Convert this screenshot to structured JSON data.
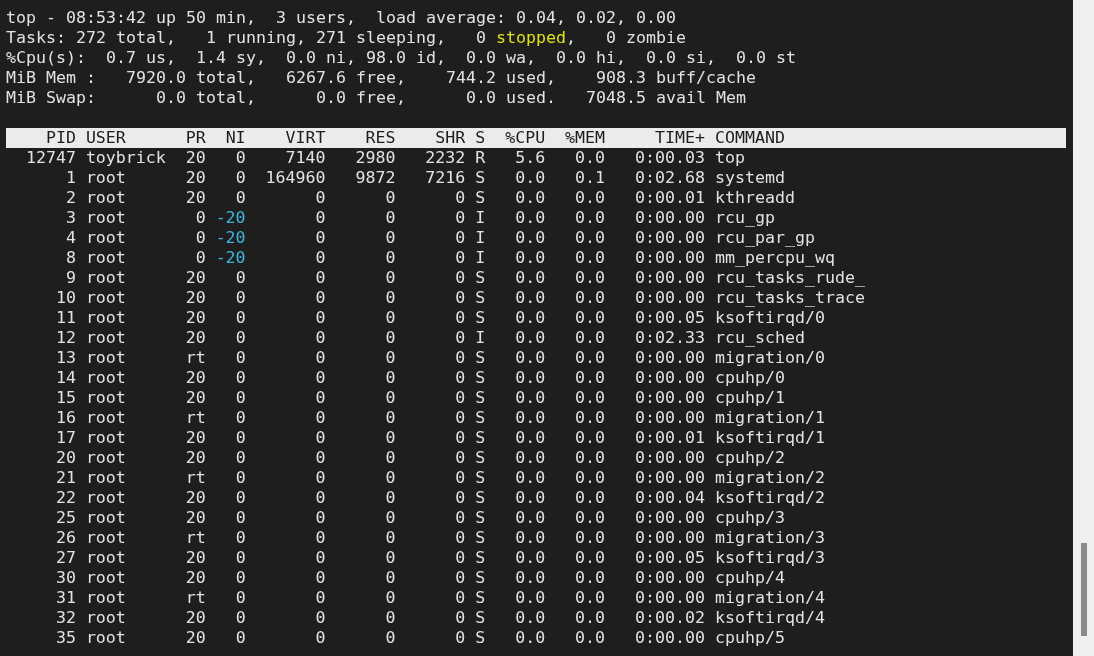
{
  "summary": [
    {
      "segments": [
        {
          "text": "top - 08:53:42 up 50 min,  3 users,  load average: 0.04, 0.02, 0.00",
          "highlighted": false
        }
      ]
    },
    {
      "segments": [
        {
          "text": "Tasks: 272 total,   1 running, 271 sleeping,   0 ",
          "highlighted": false
        },
        {
          "text": "stopped",
          "highlighted": true
        },
        {
          "text": ",   0 zombie",
          "highlighted": false
        }
      ]
    },
    {
      "segments": [
        {
          "text": "%Cpu(s):  0.7 us,  1.4 sy,  0.0 ni, 98.0 id,  0.0 wa,  0.0 hi,  0.0 si,  0.0 st",
          "highlighted": false
        }
      ]
    },
    {
      "segments": [
        {
          "text": "MiB Mem :   7920.0 total,   6267.6 free,    744.2 used,    908.3 buff/cache",
          "highlighted": false
        }
      ]
    },
    {
      "segments": [
        {
          "text": "MiB Swap:      0.0 total,      0.0 free,      0.0 used.   7048.5 avail Mem",
          "highlighted": false
        }
      ]
    }
  ],
  "process_table": {
    "columns": [
      "PID",
      "USER",
      "PR",
      "NI",
      "VIRT",
      "RES",
      "SHR",
      "S",
      "%CPU",
      "%MEM",
      "TIME+",
      "COMMAND"
    ],
    "rows": [
      {
        "cells": [
          "12747",
          "toybrick",
          "20",
          "0",
          "7140",
          "2980",
          "2232",
          "R",
          "5.6",
          "0.0",
          "0:00.03",
          "top"
        ],
        "ni_highlighted": false
      },
      {
        "cells": [
          "1",
          "root",
          "20",
          "0",
          "164960",
          "9872",
          "7216",
          "S",
          "0.0",
          "0.1",
          "0:02.68",
          "systemd"
        ],
        "ni_highlighted": false
      },
      {
        "cells": [
          "2",
          "root",
          "20",
          "0",
          "0",
          "0",
          "0",
          "S",
          "0.0",
          "0.0",
          "0:00.01",
          "kthreadd"
        ],
        "ni_highlighted": false
      },
      {
        "cells": [
          "3",
          "root",
          "0",
          "-20",
          "0",
          "0",
          "0",
          "I",
          "0.0",
          "0.0",
          "0:00.00",
          "rcu_gp"
        ],
        "ni_highlighted": true
      },
      {
        "cells": [
          "4",
          "root",
          "0",
          "-20",
          "0",
          "0",
          "0",
          "I",
          "0.0",
          "0.0",
          "0:00.00",
          "rcu_par_gp"
        ],
        "ni_highlighted": true
      },
      {
        "cells": [
          "8",
          "root",
          "0",
          "-20",
          "0",
          "0",
          "0",
          "I",
          "0.0",
          "0.0",
          "0:00.00",
          "mm_percpu_wq"
        ],
        "ni_highlighted": true
      },
      {
        "cells": [
          "9",
          "root",
          "20",
          "0",
          "0",
          "0",
          "0",
          "S",
          "0.0",
          "0.0",
          "0:00.00",
          "rcu_tasks_rude_"
        ],
        "ni_highlighted": false
      },
      {
        "cells": [
          "10",
          "root",
          "20",
          "0",
          "0",
          "0",
          "0",
          "S",
          "0.0",
          "0.0",
          "0:00.00",
          "rcu_tasks_trace"
        ],
        "ni_highlighted": false
      },
      {
        "cells": [
          "11",
          "root",
          "20",
          "0",
          "0",
          "0",
          "0",
          "S",
          "0.0",
          "0.0",
          "0:00.05",
          "ksoftirqd/0"
        ],
        "ni_highlighted": false
      },
      {
        "cells": [
          "12",
          "root",
          "20",
          "0",
          "0",
          "0",
          "0",
          "I",
          "0.0",
          "0.0",
          "0:02.33",
          "rcu_sched"
        ],
        "ni_highlighted": false
      },
      {
        "cells": [
          "13",
          "root",
          "rt",
          "0",
          "0",
          "0",
          "0",
          "S",
          "0.0",
          "0.0",
          "0:00.00",
          "migration/0"
        ],
        "ni_highlighted": false
      },
      {
        "cells": [
          "14",
          "root",
          "20",
          "0",
          "0",
          "0",
          "0",
          "S",
          "0.0",
          "0.0",
          "0:00.00",
          "cpuhp/0"
        ],
        "ni_highlighted": false
      },
      {
        "cells": [
          "15",
          "root",
          "20",
          "0",
          "0",
          "0",
          "0",
          "S",
          "0.0",
          "0.0",
          "0:00.00",
          "cpuhp/1"
        ],
        "ni_highlighted": false
      },
      {
        "cells": [
          "16",
          "root",
          "rt",
          "0",
          "0",
          "0",
          "0",
          "S",
          "0.0",
          "0.0",
          "0:00.00",
          "migration/1"
        ],
        "ni_highlighted": false
      },
      {
        "cells": [
          "17",
          "root",
          "20",
          "0",
          "0",
          "0",
          "0",
          "S",
          "0.0",
          "0.0",
          "0:00.01",
          "ksoftirqd/1"
        ],
        "ni_highlighted": false
      },
      {
        "cells": [
          "20",
          "root",
          "20",
          "0",
          "0",
          "0",
          "0",
          "S",
          "0.0",
          "0.0",
          "0:00.00",
          "cpuhp/2"
        ],
        "ni_highlighted": false
      },
      {
        "cells": [
          "21",
          "root",
          "rt",
          "0",
          "0",
          "0",
          "0",
          "S",
          "0.0",
          "0.0",
          "0:00.00",
          "migration/2"
        ],
        "ni_highlighted": false
      },
      {
        "cells": [
          "22",
          "root",
          "20",
          "0",
          "0",
          "0",
          "0",
          "S",
          "0.0",
          "0.0",
          "0:00.04",
          "ksoftirqd/2"
        ],
        "ni_highlighted": false
      },
      {
        "cells": [
          "25",
          "root",
          "20",
          "0",
          "0",
          "0",
          "0",
          "S",
          "0.0",
          "0.0",
          "0:00.00",
          "cpuhp/3"
        ],
        "ni_highlighted": false
      },
      {
        "cells": [
          "26",
          "root",
          "rt",
          "0",
          "0",
          "0",
          "0",
          "S",
          "0.0",
          "0.0",
          "0:00.00",
          "migration/3"
        ],
        "ni_highlighted": false
      },
      {
        "cells": [
          "27",
          "root",
          "20",
          "0",
          "0",
          "0",
          "0",
          "S",
          "0.0",
          "0.0",
          "0:00.05",
          "ksoftirqd/3"
        ],
        "ni_highlighted": false
      },
      {
        "cells": [
          "30",
          "root",
          "20",
          "0",
          "0",
          "0",
          "0",
          "S",
          "0.0",
          "0.0",
          "0:00.00",
          "cpuhp/4"
        ],
        "ni_highlighted": false
      },
      {
        "cells": [
          "31",
          "root",
          "rt",
          "0",
          "0",
          "0",
          "0",
          "S",
          "0.0",
          "0.0",
          "0:00.00",
          "migration/4"
        ],
        "ni_highlighted": false
      },
      {
        "cells": [
          "32",
          "root",
          "20",
          "0",
          "0",
          "0",
          "0",
          "S",
          "0.0",
          "0.0",
          "0:00.02",
          "ksoftirqd/4"
        ],
        "ni_highlighted": false
      },
      {
        "cells": [
          "35",
          "root",
          "20",
          "0",
          "0",
          "0",
          "0",
          "S",
          "0.0",
          "0.0",
          "0:00.00",
          "cpuhp/5"
        ],
        "ni_highlighted": false
      }
    ]
  }
}
